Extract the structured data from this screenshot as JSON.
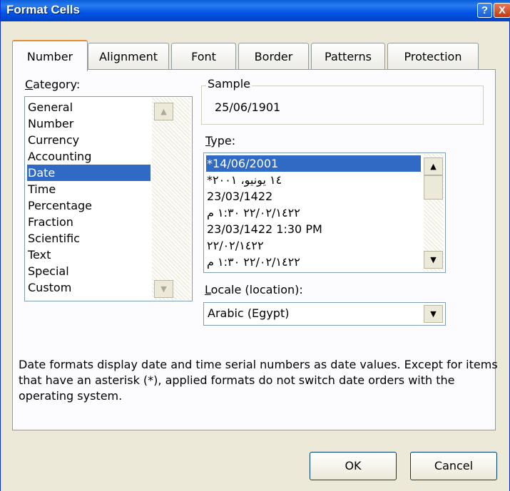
{
  "window": {
    "title": "Format Cells",
    "help_glyph": "?",
    "close_glyph": "X"
  },
  "tabs": [
    {
      "label": "Number"
    },
    {
      "label": "Alignment"
    },
    {
      "label": "Font"
    },
    {
      "label": "Border"
    },
    {
      "label": "Patterns"
    },
    {
      "label": "Protection"
    }
  ],
  "category": {
    "label_first": "C",
    "label_rest": "ategory:",
    "items": [
      "General",
      "Number",
      "Currency",
      "Accounting",
      "Date",
      "Time",
      "Percentage",
      "Fraction",
      "Scientific",
      "Text",
      "Special",
      "Custom"
    ],
    "selected": "Date"
  },
  "sample": {
    "label": "Sample",
    "value": "25/06/1901"
  },
  "type": {
    "label_first": "T",
    "label_rest": "ype:",
    "items": [
      "*14/06/2001",
      "*١٤ يونيو، ٢٠٠١",
      "23/03/1422",
      "٢٢/٠٢/١٤٢٢ ١:٣٠ م",
      "23/03/1422 1:30 PM",
      "٢٢/٠٢/١٤٢٢",
      "٢٢/٠٢/١٤٢٢ ١:٣٠ م"
    ],
    "selected": "*14/06/2001"
  },
  "locale": {
    "label_first": "L",
    "label_rest": "ocale (location):",
    "value": "Arabic (Egypt)"
  },
  "description": "Date formats display date and time serial numbers as date values. Except for items that have an asterisk (*), applied formats do not switch date orders with the operating system.",
  "buttons": {
    "ok": "OK",
    "cancel": "Cancel"
  },
  "icons": {
    "scroll_up": "scroll-up-icon",
    "scroll_down": "scroll-down-icon",
    "dropdown": "dropdown-arrow-icon"
  },
  "colors": {
    "title_bar": "#0054e3",
    "selection": "#316ac5",
    "dialog_bg": "#ece9d8",
    "active_tab_accent": "#e68b2c"
  }
}
